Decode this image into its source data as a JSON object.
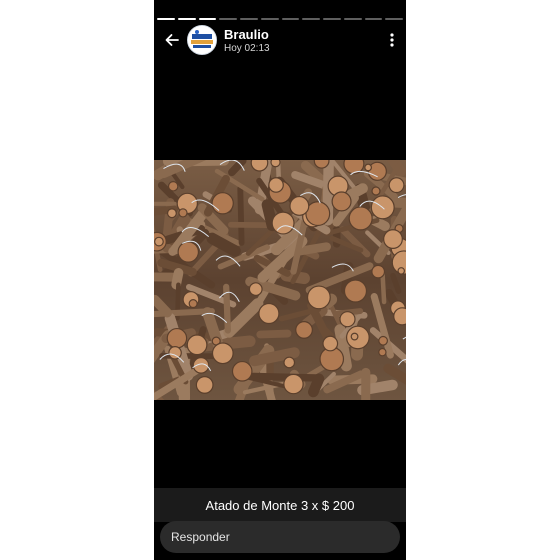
{
  "status": {
    "segments_total": 12,
    "segments_seen": 3
  },
  "colors": {
    "segment_seen": "#ffffff",
    "segment_unseen": "#5f5f5f",
    "background": "#000000"
  },
  "header": {
    "contact_name": "Braulio",
    "timestamp": "Hoy 02:13",
    "back_icon": "arrow-left-icon",
    "menu_icon": "more-vertical-icon"
  },
  "media": {
    "description_icon": "firewood-photo"
  },
  "caption": {
    "text": "Atado de Monte 3 x $ 200"
  },
  "reply": {
    "placeholder": "Responder"
  }
}
